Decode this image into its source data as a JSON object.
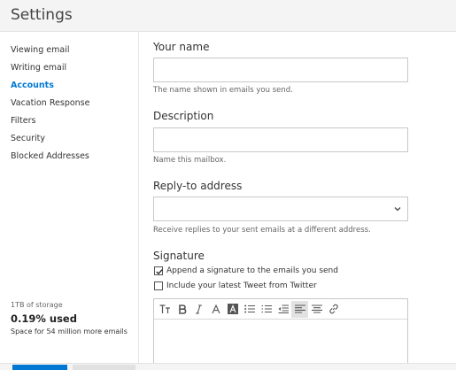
{
  "header": {
    "title": "Settings"
  },
  "sidebar": {
    "items": [
      {
        "label": "Viewing email",
        "active": false
      },
      {
        "label": "Writing email",
        "active": false
      },
      {
        "label": "Accounts",
        "active": true
      },
      {
        "label": "Vacation Response",
        "active": false
      },
      {
        "label": "Filters",
        "active": false
      },
      {
        "label": "Security",
        "active": false
      },
      {
        "label": "Blocked Addresses",
        "active": false
      }
    ],
    "storage": {
      "capacity": "1TB of storage",
      "used": "0.19% used",
      "space": "Space for 54 million more emails"
    }
  },
  "form": {
    "your_name": {
      "label": "Your name",
      "value": "",
      "hint": "The name shown in emails you send."
    },
    "description": {
      "label": "Description",
      "value": "",
      "hint": "Name this mailbox."
    },
    "reply_to": {
      "label": "Reply-to address",
      "selected": "",
      "hint": "Receive replies to your sent emails at a different address."
    },
    "signature": {
      "label": "Signature",
      "append": {
        "label": "Append a signature to the emails you send",
        "checked": true
      },
      "tweet": {
        "label": "Include your latest Tweet from Twitter",
        "checked": false
      },
      "toolbar_icons": [
        "text-size-icon",
        "bold-icon",
        "italic-icon",
        "font-color-icon",
        "highlight-icon",
        "bullet-list-icon",
        "numbered-list-icon",
        "outdent-icon",
        "align-left-icon",
        "align-center-icon",
        "link-icon"
      ]
    }
  },
  "colors": {
    "accent": "#0078d4",
    "titlebar": "#f4f4f4"
  }
}
